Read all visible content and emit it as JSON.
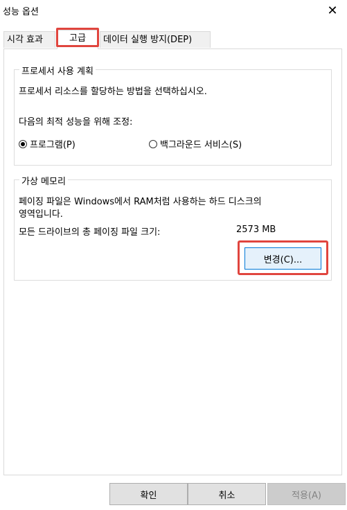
{
  "window": {
    "title": "성능 옵션",
    "close_glyph": "✕"
  },
  "tabs": [
    {
      "label": "시각 효과",
      "active": false
    },
    {
      "label": "고급",
      "active": true
    },
    {
      "label": "데이터 실행 방지(DEP)",
      "active": false
    }
  ],
  "processor": {
    "group_label": "프로세서 사용 계획",
    "description": "프로세서 리소스를 할당하는 방법을 선택하십시오.",
    "adjust_label": "다음의 최적 성능을 위해 조정:",
    "options": [
      {
        "label": "프로그램(P)",
        "checked": true
      },
      {
        "label": "백그라운드 서비스(S)",
        "checked": false
      }
    ]
  },
  "virtual_memory": {
    "group_label": "가상 메모리",
    "description_line1": "페이징 파일은 Windows에서 RAM처럼 사용하는 하드 디스크의",
    "description_line2": "영역입니다.",
    "total_label": "모든 드라이브의 총 페이징 파일 크기:",
    "total_value": "2573 MB",
    "change_button": "변경(C)..."
  },
  "footer": {
    "ok": "확인",
    "cancel": "취소",
    "apply": "적용(A)"
  },
  "colors": {
    "highlight": "#e0453e",
    "focus_border": "#0078d7"
  }
}
